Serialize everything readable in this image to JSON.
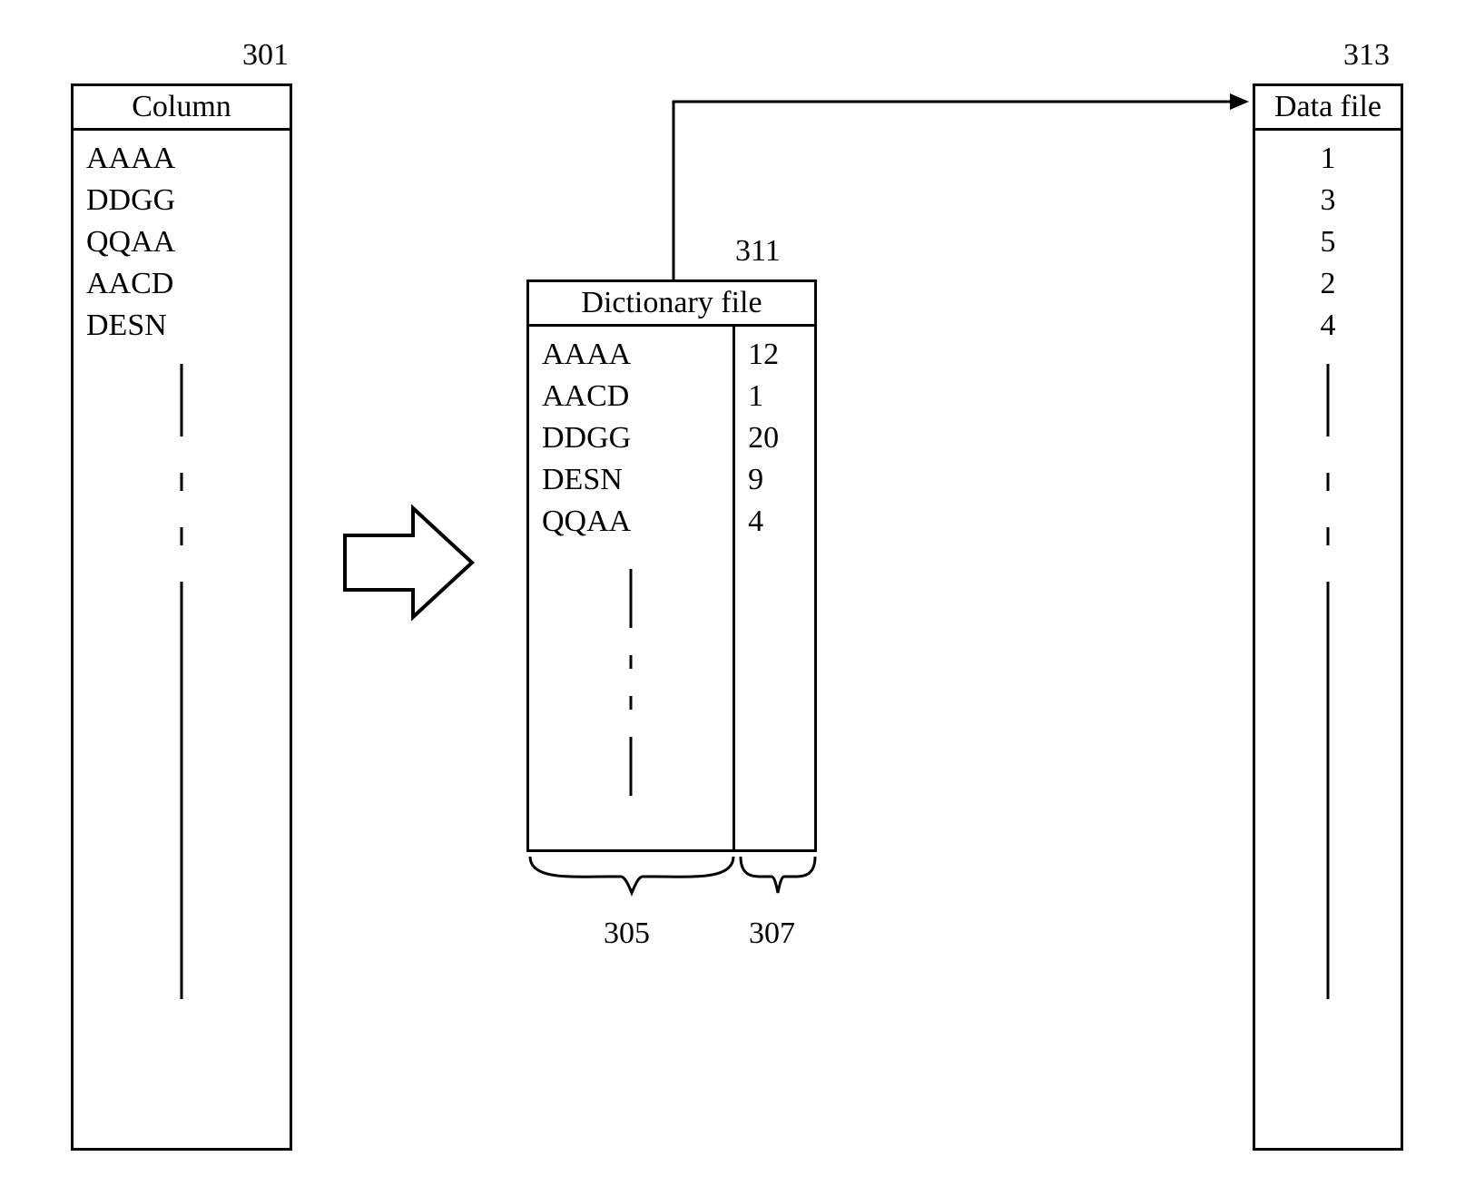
{
  "labels": {
    "column_box": "301",
    "dict_box": "311",
    "data_box": "313",
    "brace_left": "305",
    "brace_right": "307"
  },
  "column": {
    "header": "Column",
    "rows": [
      "AAAA",
      "DDGG",
      "QQAA",
      "AACD",
      "DESN"
    ]
  },
  "dictionary": {
    "header": "Dictionary file",
    "keys": [
      "AAAA",
      "AACD",
      "DDGG",
      "DESN",
      "QQAA"
    ],
    "values": [
      "12",
      "1",
      "20",
      "9",
      "4"
    ]
  },
  "datafile": {
    "header": "Data file",
    "rows": [
      "1",
      "3",
      "5",
      "2",
      "4"
    ]
  }
}
